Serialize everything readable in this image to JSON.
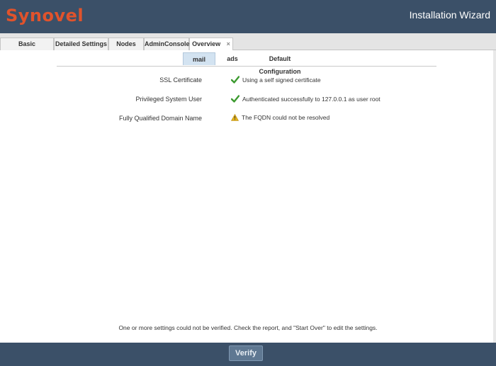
{
  "header": {
    "logo_text": "Synovel",
    "title": "Installation Wizard"
  },
  "tabs": [
    {
      "label": "Basic Information"
    },
    {
      "label": "Detailed Settings"
    },
    {
      "label": "Nodes"
    },
    {
      "label": "AdminConsole"
    },
    {
      "label": "Overview",
      "active": true,
      "close": "×"
    }
  ],
  "subtabs": [
    {
      "label": "mail",
      "active": true
    },
    {
      "label": "ads"
    },
    {
      "label": "Default Configuration"
    }
  ],
  "checks": [
    {
      "label": "SSL Certificate",
      "status": "ok",
      "icon": "check-icon",
      "message": "Using a self signed certificate"
    },
    {
      "label": "Privileged System User",
      "status": "ok",
      "icon": "check-icon",
      "message": "Authenticated successfully to 127.0.0.1 as user root"
    },
    {
      "label": "Fully Qualified Domain Name",
      "status": "warning",
      "icon": "warning-icon",
      "message": "The FQDN could not be resolved"
    }
  ],
  "footer_note": "One or more settings could not be verified. Check the report, and \"Start Over\" to edit the settings.",
  "verify_label": "Verify",
  "colors": {
    "header_bg": "#3b5068",
    "logo": "#e0532c",
    "ok": "#3c9a2f",
    "warning": "#e3b21c",
    "active_subtab": "#d3e3f1"
  }
}
